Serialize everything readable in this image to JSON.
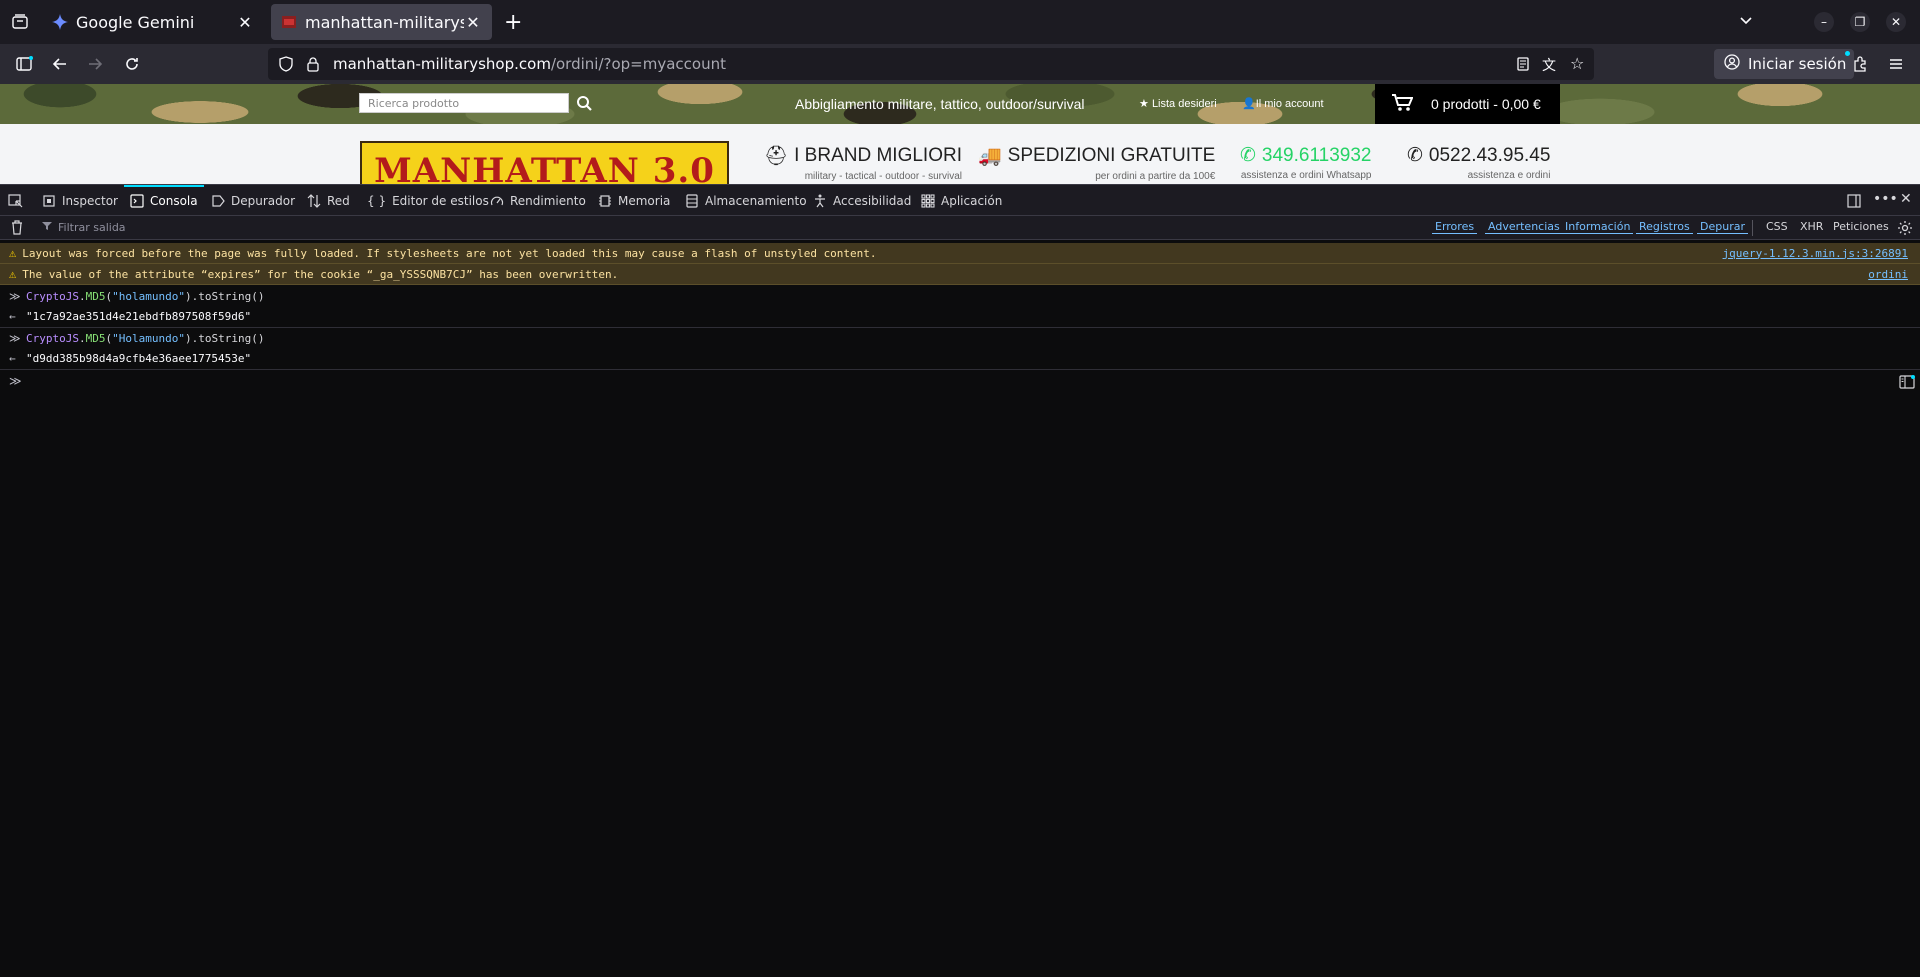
{
  "browser": {
    "tabs": [
      {
        "title": "Google Gemini",
        "active": false
      },
      {
        "title": "manhattan-militaryshop.c",
        "active": true
      }
    ],
    "new_tab": "+",
    "url_host": "manhattan-militaryshop.com",
    "url_path": "/ordini/?op=myaccount",
    "signin_label": "Iniciar sesión"
  },
  "site": {
    "search_placeholder": "Ricerca prodotto",
    "tagline": "Abbigliamento militare, tattico, outdoor/survival",
    "wishlist": "Lista desideri",
    "account": "Il mio account",
    "cart": "0 prodotti - 0,00 €",
    "logo_text": "MANHATTAN 3.0",
    "features": [
      {
        "title": "I BRAND MIGLIORI",
        "sub": "military - tactical - outdoor - survival",
        "icon": "helmet-icon"
      },
      {
        "title": "SPEDIZIONI GRATUITE",
        "sub": "per ordini a partire da 100€",
        "icon": "truck-icon"
      },
      {
        "title": "349.6113932",
        "sub": "assistenza e ordini Whatsapp",
        "icon": "whatsapp-icon",
        "color": "#25d366"
      },
      {
        "title": "0522.43.95.45",
        "sub": "assistenza e ordini",
        "icon": "phone-icon"
      }
    ]
  },
  "devtools": {
    "tabs": [
      "Inspector",
      "Consola",
      "Depurador",
      "Red",
      "Editor de estilos",
      "Rendimiento",
      "Memoria",
      "Almacenamiento",
      "Accesibilidad",
      "Aplicación"
    ],
    "active_tab": "Consola",
    "filter_placeholder": "Filtrar salida",
    "filters": [
      "Errores",
      "Advertencias",
      "Información",
      "Registros",
      "Depurar",
      "CSS",
      "XHR",
      "Peticiones"
    ],
    "warnings": [
      {
        "text": "Layout was forced before the page was fully loaded. If stylesheets are not yet loaded this may cause a flash of unstyled content.",
        "source": "jquery-1.12.3.min.js:3:26891"
      },
      {
        "text": "The value of the attribute “expires” for the cookie “_ga_YSSSQNB7CJ” has been overwritten.",
        "source": "ordini"
      }
    ],
    "commands": [
      {
        "obj": "CryptoJS",
        "dot1": ".",
        "fn": "MD5",
        "arg": "\"holamundo\"",
        "tail": ").toString()",
        "result": "\"1c7a92ae351d4e21ebdfb897508f59d6\""
      },
      {
        "obj": "CryptoJS",
        "dot1": ".",
        "fn": "MD5",
        "arg": "\"Holamundo\"",
        "tail": ").toString()",
        "result": "\"d9dd385b98d4a9cfb4e36aee1775453e\""
      }
    ]
  }
}
